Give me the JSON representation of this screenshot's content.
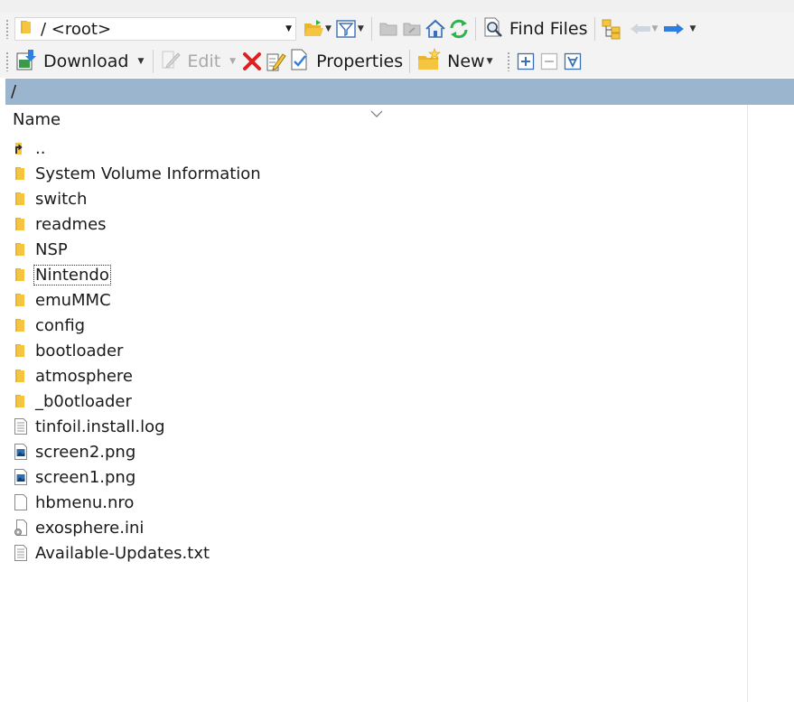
{
  "toolbar1": {
    "path_value": "/ <root>",
    "find_files_label": "Find Files"
  },
  "toolbar2": {
    "download_label": "Download",
    "edit_label": "Edit",
    "properties_label": "Properties",
    "new_label": "New"
  },
  "path_bar": {
    "path": "/"
  },
  "list": {
    "column_name": "Name",
    "items": [
      {
        "name": "..",
        "type": "parent"
      },
      {
        "name": "System Volume Information",
        "type": "folder"
      },
      {
        "name": "switch",
        "type": "folder"
      },
      {
        "name": "readmes",
        "type": "folder"
      },
      {
        "name": "NSP",
        "type": "folder"
      },
      {
        "name": "Nintendo",
        "type": "folder"
      },
      {
        "name": "emuMMC",
        "type": "folder"
      },
      {
        "name": "config",
        "type": "folder"
      },
      {
        "name": "bootloader",
        "type": "folder"
      },
      {
        "name": "atmosphere",
        "type": "folder"
      },
      {
        "name": "_b0otloader",
        "type": "folder"
      },
      {
        "name": "tinfoil.install.log",
        "type": "text"
      },
      {
        "name": "screen2.png",
        "type": "image"
      },
      {
        "name": "screen1.png",
        "type": "image"
      },
      {
        "name": "hbmenu.nro",
        "type": "blank"
      },
      {
        "name": "exosphere.ini",
        "type": "config"
      },
      {
        "name": "Available-Updates.txt",
        "type": "text"
      }
    ]
  },
  "colors": {
    "path_bar": "#9bb5cf",
    "toolbar_bg": "#f3f3f3",
    "folder": "#f5c542",
    "refresh": "#2db34a",
    "delete": "#e02020",
    "arrow_forward": "#2f7fe0"
  }
}
